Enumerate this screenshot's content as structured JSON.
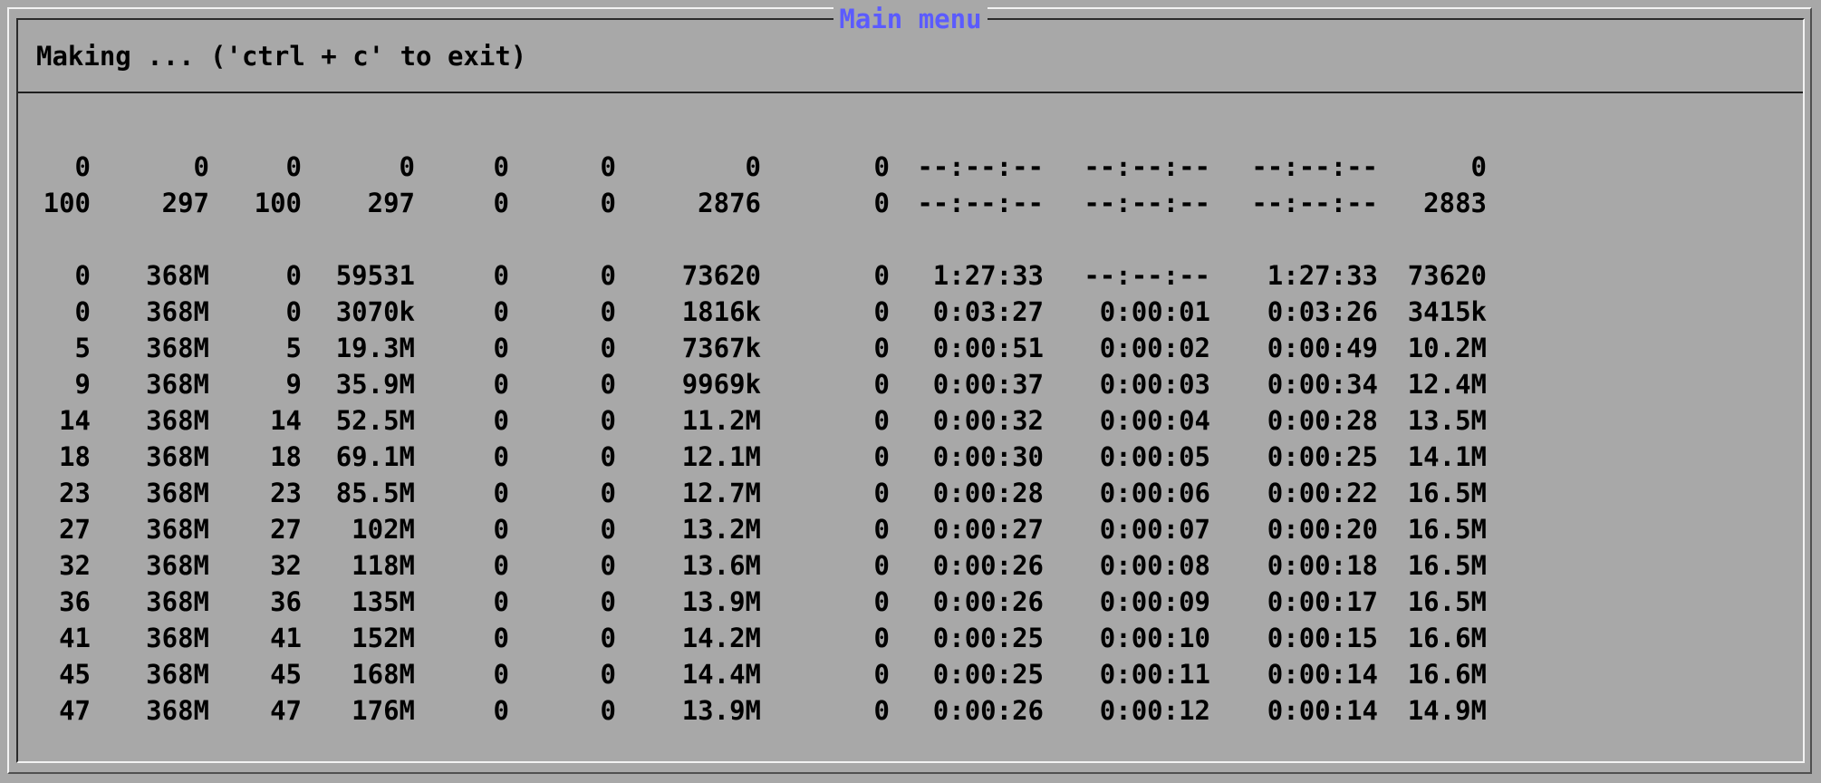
{
  "window": {
    "title": "Main menu",
    "status": "Making ... ('ctrl + c' to exit)"
  },
  "colors": {
    "background": "#a8a8a8",
    "title": "#5b5bff",
    "text": "#000000"
  },
  "table": {
    "summary_rows": [
      [
        "0",
        "0",
        "0",
        "0",
        "0",
        "0",
        "0",
        "0",
        "--:--:--",
        "--:--:--",
        "--:--:--",
        "0"
      ],
      [
        "100",
        "297",
        "100",
        "297",
        "0",
        "0",
        "2876",
        "0",
        "--:--:--",
        "--:--:--",
        "--:--:--",
        "2883"
      ]
    ],
    "detail_rows": [
      [
        "0",
        "368M",
        "0",
        "59531",
        "0",
        "0",
        "73620",
        "0",
        "1:27:33",
        "--:--:--",
        "1:27:33",
        "73620"
      ],
      [
        "0",
        "368M",
        "0",
        "3070k",
        "0",
        "0",
        "1816k",
        "0",
        "0:03:27",
        "0:00:01",
        "0:03:26",
        "3415k"
      ],
      [
        "5",
        "368M",
        "5",
        "19.3M",
        "0",
        "0",
        "7367k",
        "0",
        "0:00:51",
        "0:00:02",
        "0:00:49",
        "10.2M"
      ],
      [
        "9",
        "368M",
        "9",
        "35.9M",
        "0",
        "0",
        "9969k",
        "0",
        "0:00:37",
        "0:00:03",
        "0:00:34",
        "12.4M"
      ],
      [
        "14",
        "368M",
        "14",
        "52.5M",
        "0",
        "0",
        "11.2M",
        "0",
        "0:00:32",
        "0:00:04",
        "0:00:28",
        "13.5M"
      ],
      [
        "18",
        "368M",
        "18",
        "69.1M",
        "0",
        "0",
        "12.1M",
        "0",
        "0:00:30",
        "0:00:05",
        "0:00:25",
        "14.1M"
      ],
      [
        "23",
        "368M",
        "23",
        "85.5M",
        "0",
        "0",
        "12.7M",
        "0",
        "0:00:28",
        "0:00:06",
        "0:00:22",
        "16.5M"
      ],
      [
        "27",
        "368M",
        "27",
        "102M",
        "0",
        "0",
        "13.2M",
        "0",
        "0:00:27",
        "0:00:07",
        "0:00:20",
        "16.5M"
      ],
      [
        "32",
        "368M",
        "32",
        "118M",
        "0",
        "0",
        "13.6M",
        "0",
        "0:00:26",
        "0:00:08",
        "0:00:18",
        "16.5M"
      ],
      [
        "36",
        "368M",
        "36",
        "135M",
        "0",
        "0",
        "13.9M",
        "0",
        "0:00:26",
        "0:00:09",
        "0:00:17",
        "16.5M"
      ],
      [
        "41",
        "368M",
        "41",
        "152M",
        "0",
        "0",
        "14.2M",
        "0",
        "0:00:25",
        "0:00:10",
        "0:00:15",
        "16.6M"
      ],
      [
        "45",
        "368M",
        "45",
        "168M",
        "0",
        "0",
        "14.4M",
        "0",
        "0:00:25",
        "0:00:11",
        "0:00:14",
        "16.6M"
      ],
      [
        "47",
        "368M",
        "47",
        "176M",
        "0",
        "0",
        "13.9M",
        "0",
        "0:00:26",
        "0:00:12",
        "0:00:14",
        "14.9M"
      ]
    ]
  }
}
